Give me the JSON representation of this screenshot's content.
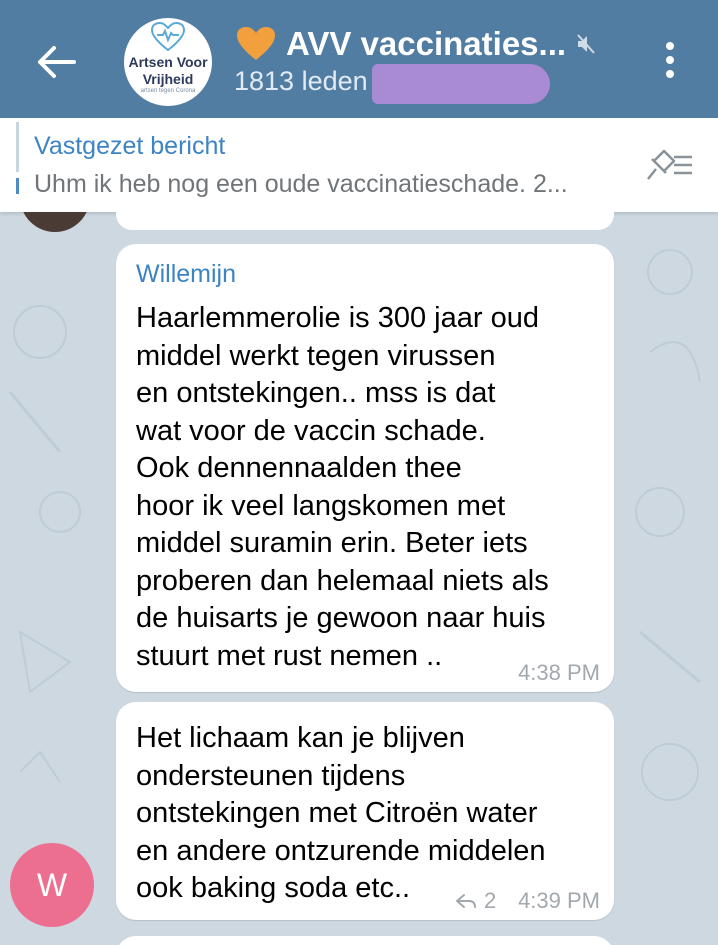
{
  "header": {
    "title": "AVV vaccinaties...",
    "members": "1813 leden",
    "logo": {
      "line1": "Artsen Voor",
      "line2": "Vrijheid",
      "line3": "artsen tegen Corona"
    },
    "accent_color": "#527da3"
  },
  "pinned": {
    "title": "Vastgezet bericht",
    "text": "Uhm ik heb nog een oude vaccinatieschade. 2..."
  },
  "messages": [
    {
      "sender": "Willemijn",
      "text": "Haarlemmerolie is 300 jaar oud\nmiddel werkt tegen virussen\nen ontstekingen.. mss is dat\nwat voor de vaccin schade.\nOok dennennaalden thee\nhoor ik veel langskomen met\nmiddel suramin erin. Beter iets\nproberen dan helemaal niets als\nde huisarts je gewoon naar huis\nstuurt met rust nemen ..",
      "time": "4:38 PM"
    },
    {
      "text": "Het lichaam kan je blijven\nondersteunen tijdens\nontstekingen met Citroën water\nen andere ontzurende middelen\nook baking soda etc..",
      "time": "4:39 PM",
      "replies": "2",
      "avatar_letter": "W",
      "avatar_color": "#ec6f8f"
    }
  ],
  "icons": {
    "back": "arrow-left-icon",
    "status": "orange-heart-icon",
    "mute": "muted-speaker-icon",
    "menu": "more-vertical-icon",
    "unpin": "pin-list-icon",
    "reply": "reply-arrow-icon"
  }
}
